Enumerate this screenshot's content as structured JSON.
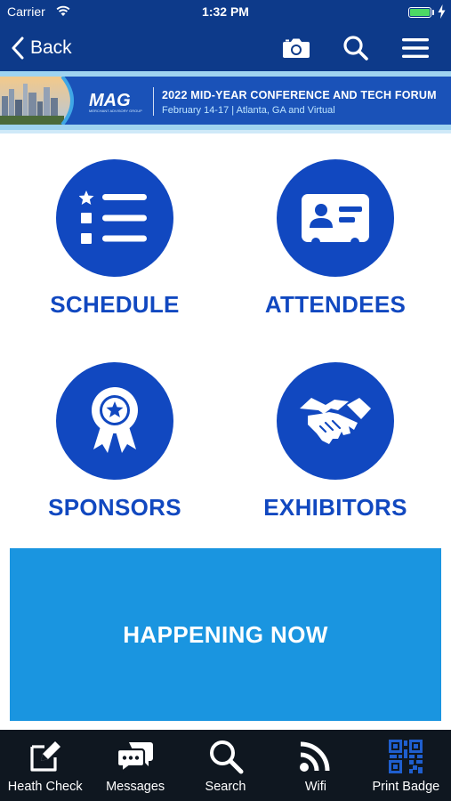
{
  "status_bar": {
    "carrier": "Carrier",
    "time": "1:32 PM",
    "battery_level": 1.0
  },
  "nav": {
    "back_label": "Back",
    "icons": [
      "camera-icon",
      "search-icon",
      "menu-icon"
    ]
  },
  "banner": {
    "logo_text": "MAG",
    "logo_subtext": "MERCHANT ADVISORY GROUP",
    "title": "2022 MID-YEAR CONFERENCE AND TECH FORUM",
    "subtitle": "February 14-17  |  Atlanta, GA and Virtual"
  },
  "tiles": [
    {
      "label": "SCHEDULE",
      "icon": "schedule-list-icon"
    },
    {
      "label": "ATTENDEES",
      "icon": "id-card-icon"
    },
    {
      "label": "SPONSORS",
      "icon": "award-ribbon-icon"
    },
    {
      "label": "EXHIBITORS",
      "icon": "handshake-icon"
    }
  ],
  "happening_now": {
    "label": "HAPPENING NOW"
  },
  "tab_bar": [
    {
      "label": "Heath Check",
      "icon": "edit-note-icon"
    },
    {
      "label": "Messages",
      "icon": "chat-bubbles-icon"
    },
    {
      "label": "Search",
      "icon": "search-icon"
    },
    {
      "label": "Wifi",
      "icon": "wifi-icon"
    },
    {
      "label": "Print Badge",
      "icon": "qr-code-icon",
      "active": true
    }
  ],
  "colors": {
    "nav_background": "#0d3a8a",
    "tile_blue": "#1148c0",
    "happening_blue": "#1a95e0",
    "tab_background": "#0f1720",
    "active_tab": "#1f5fcf",
    "battery_green": "#4cd964"
  }
}
